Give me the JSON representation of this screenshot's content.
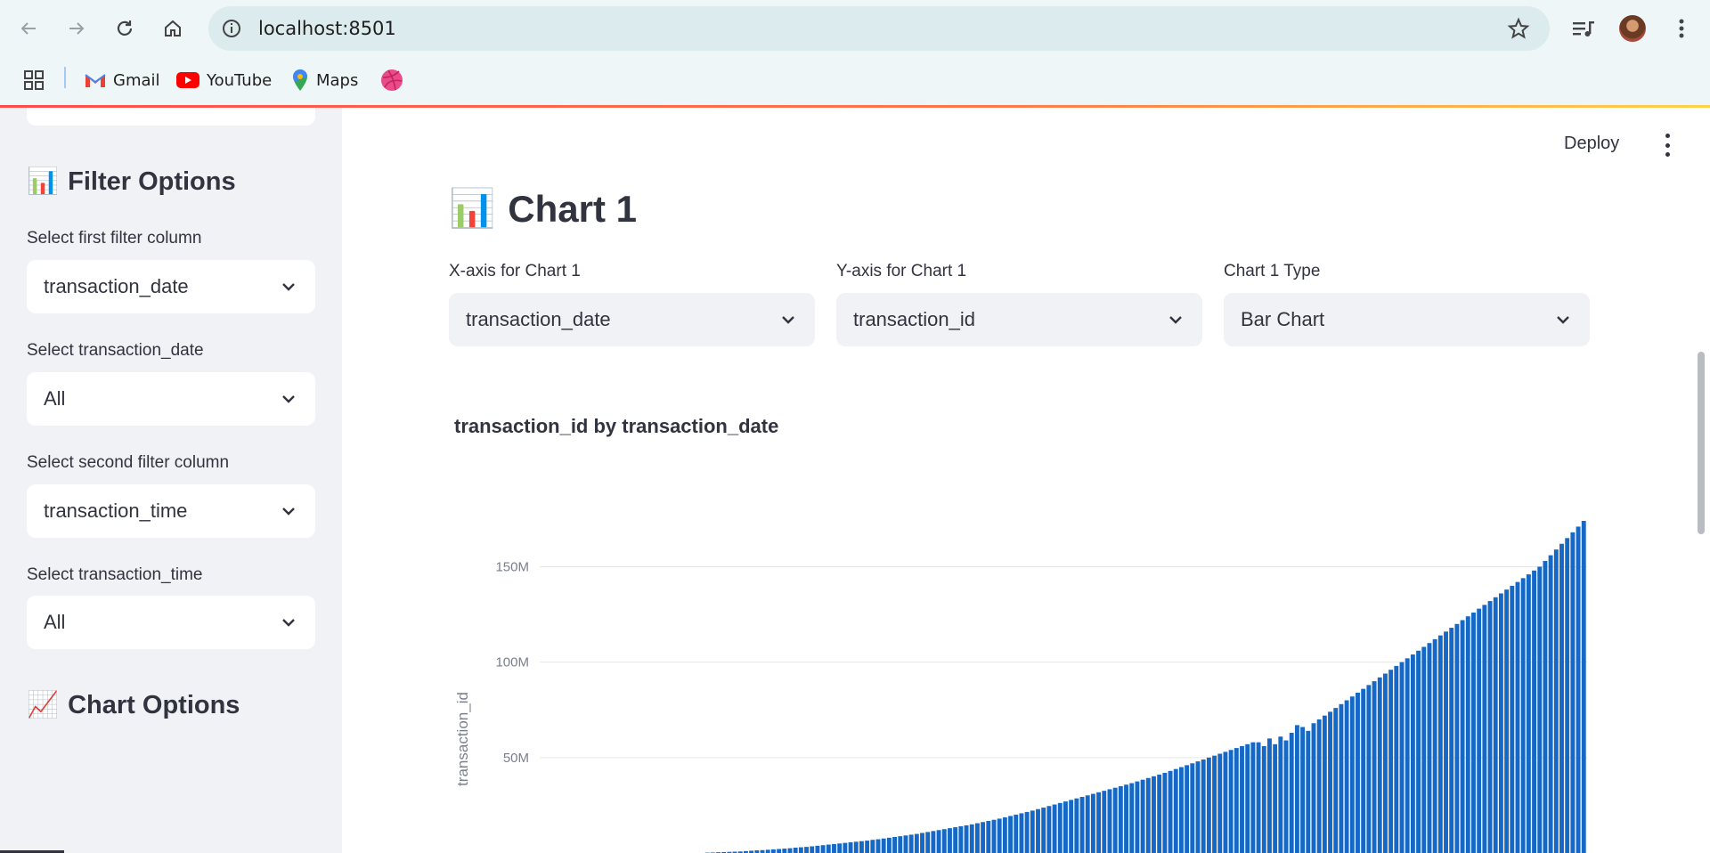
{
  "browser": {
    "url": "localhost:8501",
    "bookmarks": [
      "Gmail",
      "YouTube",
      "Maps"
    ]
  },
  "sidebar": {
    "filter_heading_icon": "📊",
    "filter_heading": "Filter Options",
    "first_filter_label": "Select first filter column",
    "first_filter_value": "transaction_date",
    "date_filter_label": "Select transaction_date",
    "date_filter_value": "All",
    "second_filter_label": "Select second filter column",
    "second_filter_value": "transaction_time",
    "time_filter_label": "Select transaction_time",
    "time_filter_value": "All",
    "chart_heading_icon": "📈",
    "chart_heading": "Chart Options"
  },
  "header": {
    "deploy_label": "Deploy"
  },
  "main": {
    "title_icon": "📊",
    "title": "Chart 1",
    "x_axis_label": "X-axis for Chart 1",
    "x_axis_value": "transaction_date",
    "y_axis_label": "Y-axis for Chart 1",
    "y_axis_value": "transaction_id",
    "type_label": "Chart 1 Type",
    "type_value": "Bar Chart"
  },
  "colors": {
    "bar": "#1668c7",
    "grid": "#e6e6e6",
    "tick": "#7a7f8c"
  },
  "chart_data": {
    "type": "bar",
    "title": "transaction_id by transaction_date",
    "ylabel": "transaction_id",
    "xlabel": "",
    "yticks": [
      "50M",
      "100M",
      "150M"
    ],
    "ytick_values": [
      50000000,
      100000000,
      150000000
    ],
    "ylim": [
      0,
      195000000
    ],
    "values": [
      0,
      0,
      0,
      0,
      0,
      0,
      0,
      0,
      0,
      0,
      0,
      0,
      0,
      0,
      0,
      0,
      0,
      0,
      0,
      0,
      0,
      0,
      0,
      0,
      0,
      0,
      0,
      0,
      0,
      0,
      200000,
      300000,
      400000,
      500000,
      600000,
      700000,
      800000,
      1000000,
      1200000,
      1400000,
      1500000,
      1700000,
      1900000,
      2100000,
      2300000,
      2500000,
      2800000,
      3000000,
      3200000,
      3500000,
      3800000,
      4100000,
      4400000,
      4700000,
      5000000,
      5300000,
      5600000,
      5900000,
      6200000,
      6500000,
      6900000,
      7200000,
      7600000,
      8000000,
      8400000,
      8800000,
      9200000,
      9600000,
      10000000,
      10500000,
      11000000,
      11500000,
      12000000,
      12500000,
      13000000,
      13500000,
      14000000,
      14500000,
      15000000,
      15600000,
      16200000,
      16800000,
      17400000,
      18000000,
      18700000,
      19400000,
      20100000,
      20800000,
      21500000,
      22200000,
      23000000,
      23800000,
      24600000,
      25400000,
      26200000,
      27000000,
      27800000,
      28600000,
      29400000,
      30200000,
      31000000,
      31800000,
      32600000,
      33400000,
      34200000,
      35000000,
      35800000,
      36600000,
      37500000,
      38400000,
      39300000,
      40200000,
      41100000,
      42000000,
      43000000,
      44000000,
      45000000,
      46000000,
      47000000,
      48000000,
      49000000,
      50000000,
      51000000,
      52000000,
      53000000,
      54000000,
      55000000,
      56000000,
      57000000,
      58000000,
      58000000,
      56000000,
      60000000,
      57000000,
      61000000,
      59000000,
      63000000,
      67000000,
      66000000,
      64000000,
      68000000,
      70000000,
      72000000,
      74000000,
      76000000,
      78000000,
      80000000,
      82000000,
      84000000,
      86000000,
      88000000,
      90000000,
      92000000,
      94000000,
      96000000,
      98000000,
      100000000,
      102000000,
      104000000,
      106000000,
      108000000,
      110000000,
      112000000,
      114000000,
      116000000,
      118000000,
      120000000,
      122000000,
      124000000,
      126000000,
      128000000,
      130000000,
      132000000,
      134000000,
      136000000,
      138000000,
      140000000,
      142000000,
      144000000,
      146000000,
      148000000,
      150000000,
      153000000,
      156000000,
      159000000,
      162000000,
      165000000,
      168000000,
      171000000,
      174000000
    ]
  }
}
